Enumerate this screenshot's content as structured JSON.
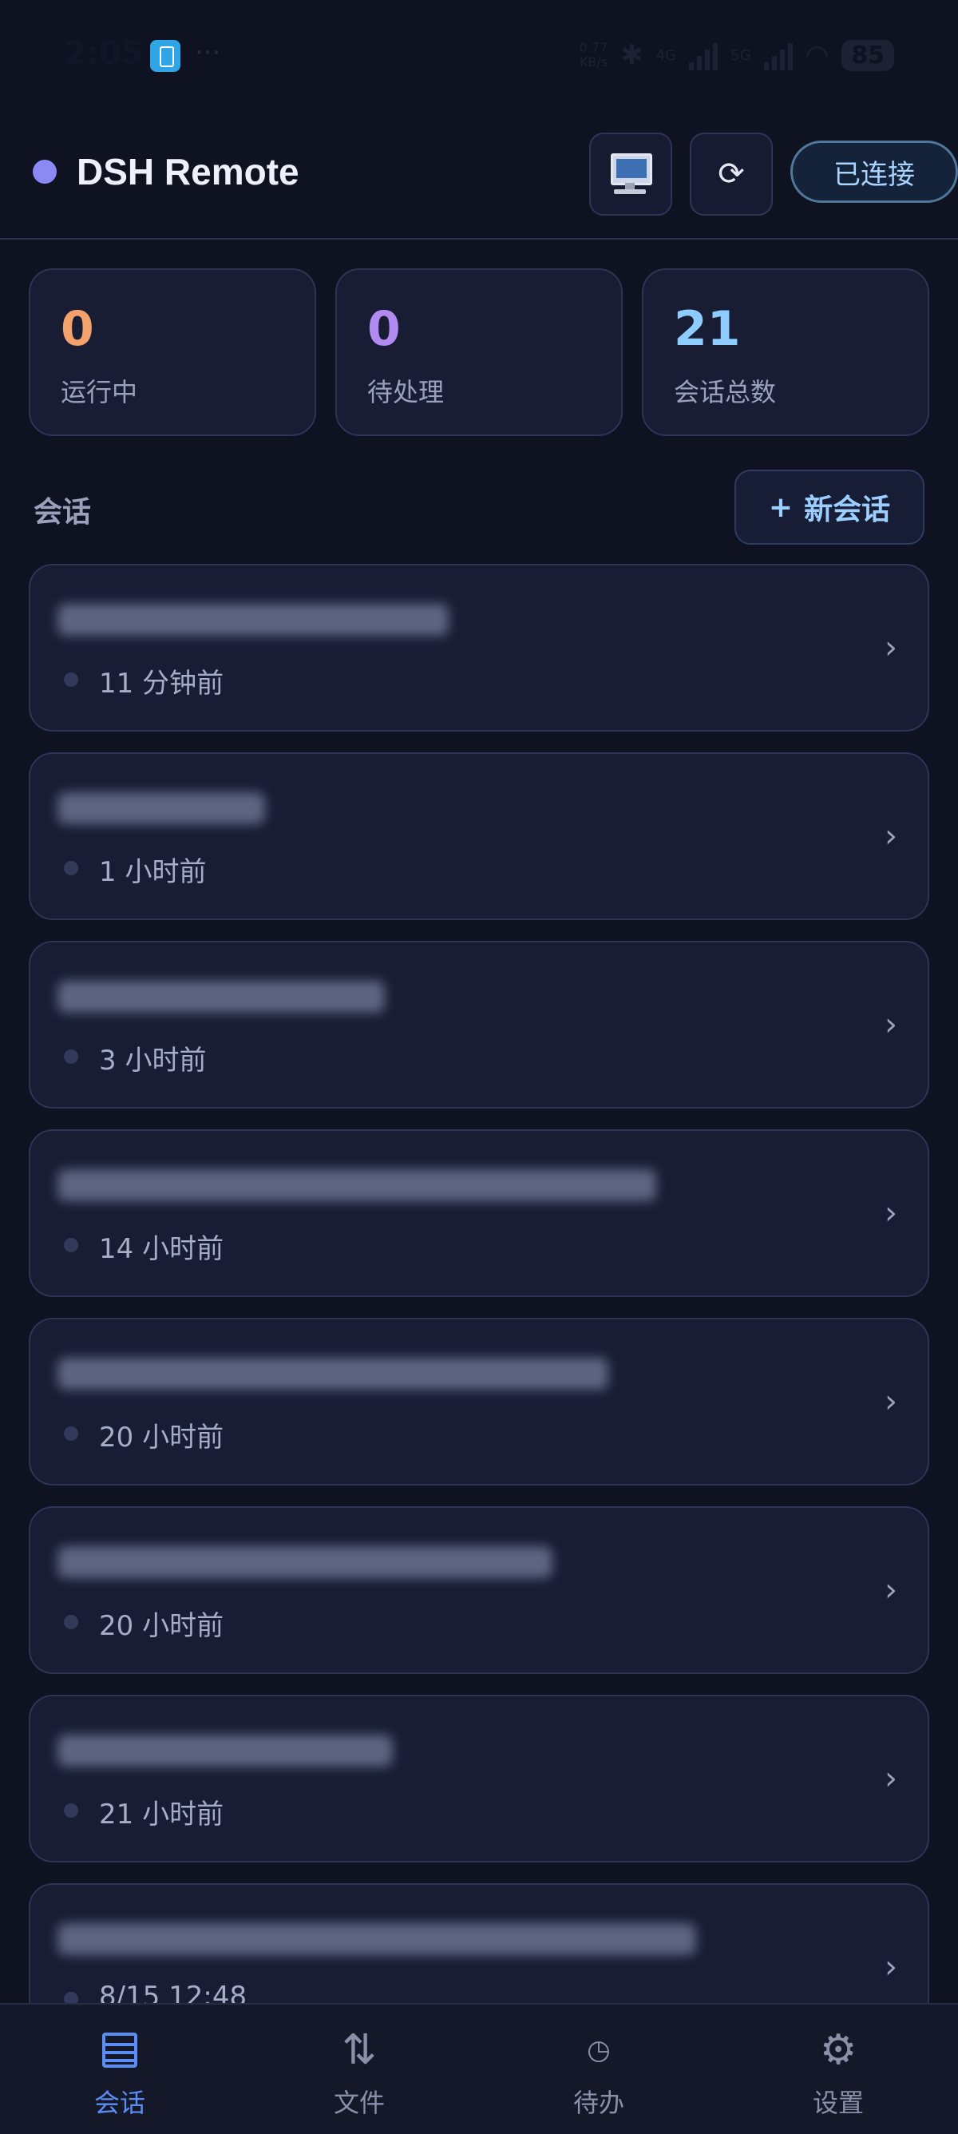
{
  "status_bar": {
    "time": "2:05",
    "more": "···",
    "net_speed_value": "0.77",
    "net_speed_unit": "KB/s",
    "net1": "4G",
    "net2": "5G",
    "battery": "85"
  },
  "header": {
    "title": "DSH Remote",
    "monitor_icon": "desktop-computer",
    "refresh_icon": "⟳",
    "connection_status": "已连接"
  },
  "stats": [
    {
      "value": "0",
      "label": "运行中",
      "color": "#f4a26b"
    },
    {
      "value": "0",
      "label": "待处理",
      "color": "#b18bf2"
    },
    {
      "value": "21",
      "label": "会话总数",
      "color": "#8ecbff"
    }
  ],
  "sessions": {
    "section_title": "会话",
    "new_button_icon": "+",
    "new_button_label": "新会话",
    "items": [
      {
        "time": "11 分钟前"
      },
      {
        "time": "1 小时前"
      },
      {
        "time": "3 小时前"
      },
      {
        "time": "14 小时前"
      },
      {
        "time": "20 小时前"
      },
      {
        "time": "20 小时前"
      },
      {
        "time": "21 小时前"
      },
      {
        "time": "8/15 12:48"
      }
    ],
    "chevron": "›"
  },
  "tabbar": {
    "tabs": [
      {
        "label": "会话",
        "icon": "list-icon"
      },
      {
        "label": "文件",
        "icon": "transfer-icon"
      },
      {
        "label": "待办",
        "icon": "clock-icon"
      },
      {
        "label": "设置",
        "icon": "gear-icon"
      }
    ]
  }
}
